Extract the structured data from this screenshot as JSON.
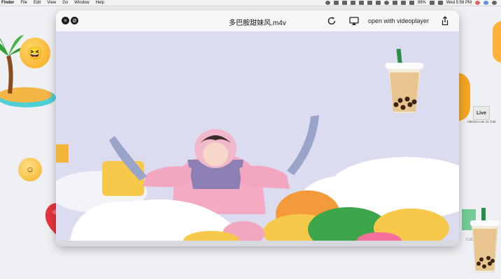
{
  "menubar": {
    "items": [
      "Finder",
      "File",
      "Edit",
      "View",
      "Go",
      "Window",
      "Help"
    ],
    "battery": "99%",
    "clock": "Wed 5:56 PM"
  },
  "desktop": {
    "app_icon_text": "Live",
    "app_icon_label": "Ableton Live 11 Trial",
    "cute_text": "cute"
  },
  "window": {
    "title": "多巴胺甜妹风.m4v",
    "open_with_label": "open with videoplayer",
    "buttons": {
      "close": "×",
      "hide": "⊘"
    }
  },
  "colors": {
    "video_bg": "#dcdcf1",
    "cushion_orange": "#f39a3b",
    "cushion_green": "#3ea64a",
    "cushion_yellow": "#f7c94a",
    "heart": "#e7343f"
  },
  "icons": {
    "reload": "reload-icon",
    "airplay": "airplay-icon",
    "share": "share-icon"
  }
}
